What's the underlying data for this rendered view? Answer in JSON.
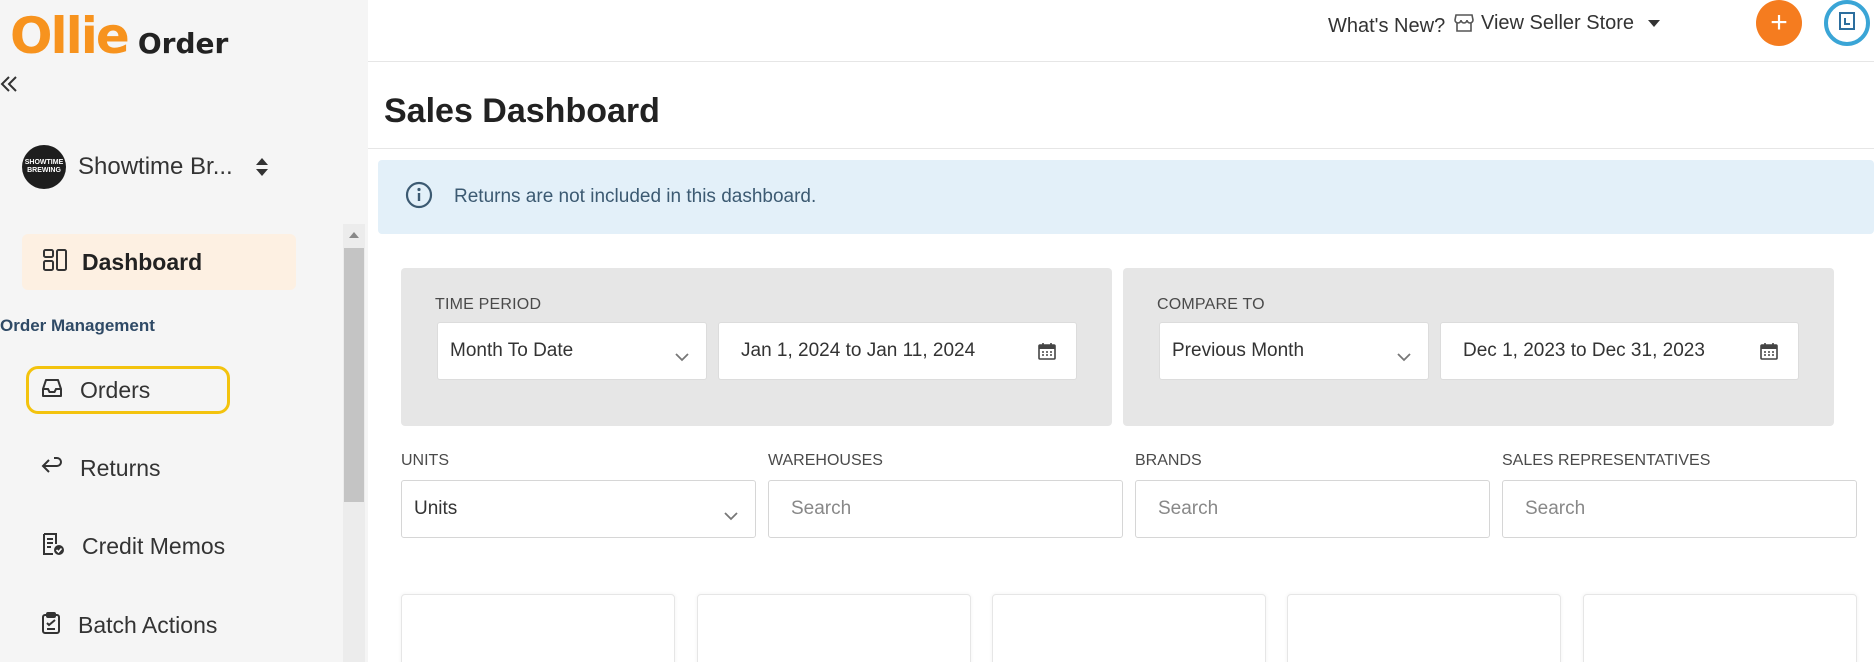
{
  "brand": {
    "name": "Ollie",
    "product": "Order"
  },
  "store": {
    "name": "Showtime Br...",
    "avatar_text": "SHOWTIME BREWING"
  },
  "sidebar": {
    "dashboard_label": "Dashboard",
    "section_title": "Order Management",
    "items": [
      {
        "label": "Orders",
        "icon": "inbox-icon"
      },
      {
        "label": "Returns",
        "icon": "return-arrow-icon"
      },
      {
        "label": "Credit Memos",
        "icon": "credit-memo-icon"
      },
      {
        "label": "Batch Actions",
        "icon": "clipboard-check-icon"
      }
    ]
  },
  "topbar": {
    "whats_new": "What's New?",
    "view_store": "View Seller Store",
    "plus_icon": "+",
    "accent": "#f57c1f",
    "avatar_ring": "#3aa5d6"
  },
  "main": {
    "title": "Sales Dashboard",
    "info_text": "Returns are not included in this dashboard.",
    "time_period": {
      "label": "TIME PERIOD",
      "selected": "Month To Date",
      "range": "Jan 1, 2024 to Jan 11, 2024"
    },
    "compare_to": {
      "label": "COMPARE TO",
      "selected": "Previous Month",
      "range": "Dec 1, 2023 to Dec 31, 2023"
    },
    "filters": {
      "units_label": "UNITS",
      "units_value": "Units",
      "warehouses_label": "WAREHOUSES",
      "warehouses_placeholder": "Search",
      "brands_label": "BRANDS",
      "brands_placeholder": "Search",
      "reps_label": "SALES REPRESENTATIVES",
      "reps_placeholder": "Search"
    }
  },
  "colors": {
    "brand_orange": "#f7931e",
    "highlight_yellow": "#f3c30e",
    "info_bg": "#e3f0f9"
  }
}
